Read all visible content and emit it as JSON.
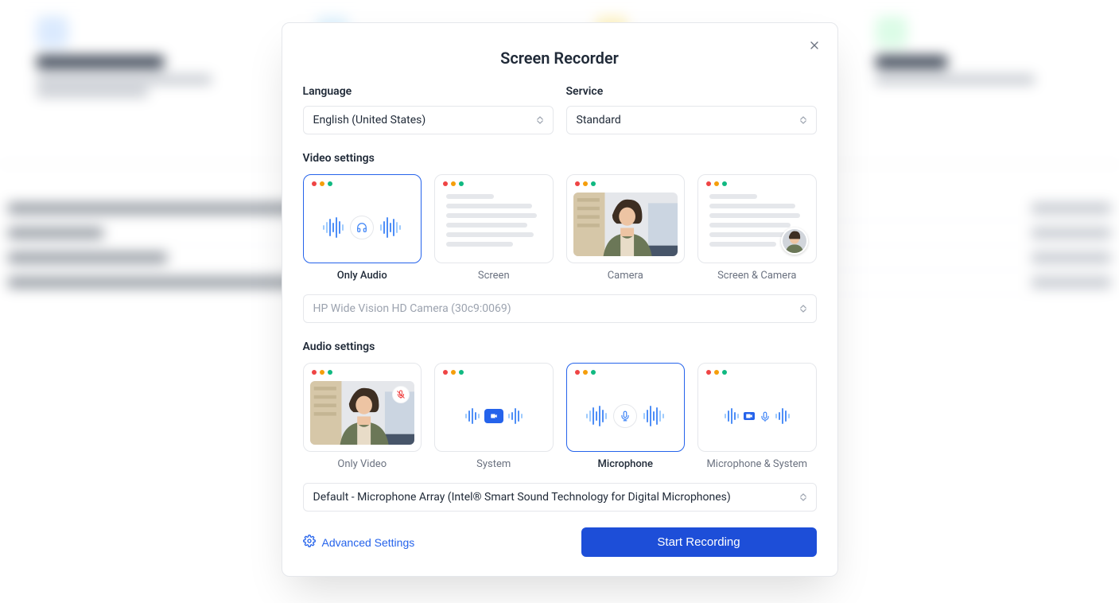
{
  "modal": {
    "title": "Screen Recorder",
    "language_label": "Language",
    "language_value": "English (United States)",
    "service_label": "Service",
    "service_value": "Standard",
    "video_settings_label": "Video settings",
    "video_options": {
      "only_audio": "Only Audio",
      "screen": "Screen",
      "camera": "Camera",
      "screen_camera": "Screen & Camera"
    },
    "camera_device": "HP Wide Vision HD Camera (30c9:0069)",
    "audio_settings_label": "Audio settings",
    "audio_options": {
      "only_video": "Only Video",
      "system": "System",
      "microphone": "Microphone",
      "microphone_system": "Microphone & System"
    },
    "microphone_device": "Default - Microphone Array (Intel® Smart Sound Technology for Digital Microphones)",
    "advanced_settings": "Advanced Settings",
    "start_recording": "Start Recording"
  }
}
